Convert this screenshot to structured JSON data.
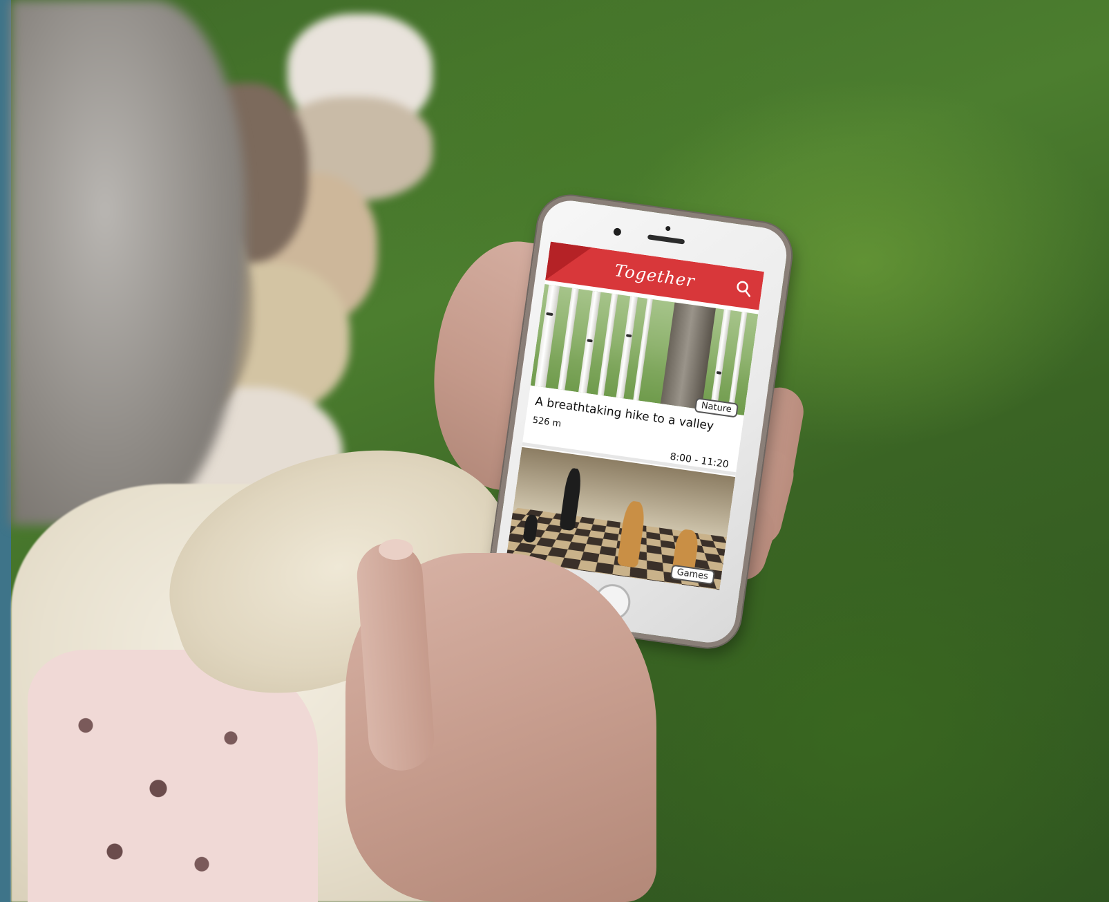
{
  "app": {
    "title": "Together",
    "header_color": "#d8373a",
    "search_icon": "search-icon"
  },
  "cards": [
    {
      "title": "A breathtaking hike to a valley",
      "distance": "526 m",
      "time": "8:00 - 11:20",
      "tag": "Nature",
      "image": "birch-forest"
    },
    {
      "tag": "Games",
      "image": "chess-board"
    }
  ]
}
